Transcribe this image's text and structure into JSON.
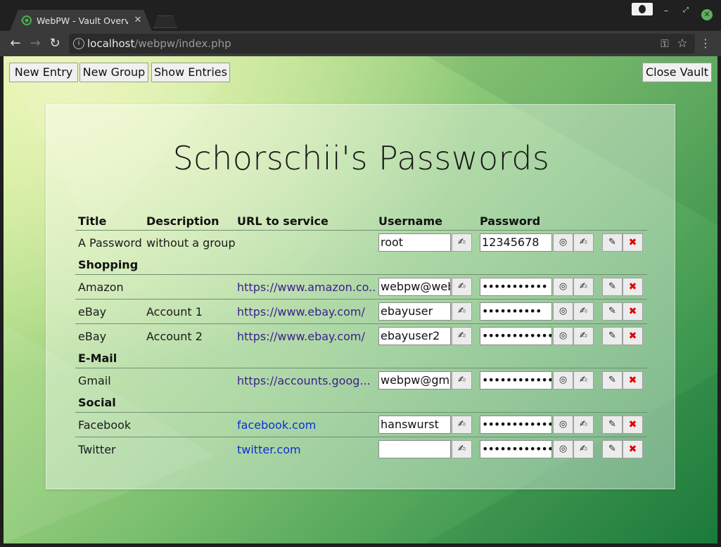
{
  "browser": {
    "tab_title": "WebPW - Vault Overview",
    "url_host": "localhost",
    "url_path": "/webpw/index.php"
  },
  "toolbar": {
    "new_entry": "New Entry",
    "new_group": "New Group",
    "show_entries": "Show Entries",
    "close_vault": "Close Vault"
  },
  "page": {
    "title": "Schorschii's Passwords"
  },
  "table": {
    "headers": [
      "Title",
      "Description",
      "URL to service",
      "Username",
      "Password"
    ],
    "rows": [
      {
        "title": "A Password",
        "description": "without a group",
        "url": "",
        "username": "root",
        "password": "12345678"
      },
      {
        "group": "Shopping"
      },
      {
        "title": "Amazon",
        "description": "",
        "url": "https://www.amazon.co...",
        "username": "webpw@web",
        "password": "•••••••••••"
      },
      {
        "title": "eBay",
        "description": "Account 1",
        "url": "https://www.ebay.com/",
        "username": "ebayuser",
        "password": "••••••••••"
      },
      {
        "title": "eBay",
        "description": "Account 2",
        "url": "https://www.ebay.com/",
        "username": "ebayuser2",
        "password": "•••••••••••••"
      },
      {
        "group": "E-Mail"
      },
      {
        "title": "Gmail",
        "description": "",
        "url": "https://accounts.goog...",
        "username": "webpw@gma",
        "password": "••••••••••••"
      },
      {
        "group": "Social"
      },
      {
        "title": "Facebook",
        "description": "",
        "url": "facebook.com",
        "username": "hanswurst",
        "password": "••••••••••••"
      },
      {
        "title": "Twitter",
        "description": "",
        "url": "twitter.com",
        "username": "",
        "password": "••••••••••••••"
      }
    ]
  },
  "icons": {
    "copy": "✍",
    "show": "◎",
    "edit": "✎",
    "delete": "✖",
    "key": "⚿",
    "star": "☆",
    "menu": "⋮"
  },
  "colors": {
    "delete": "#e00000",
    "link_visited": "#3b1e8c",
    "link": "#0b2fd6"
  }
}
